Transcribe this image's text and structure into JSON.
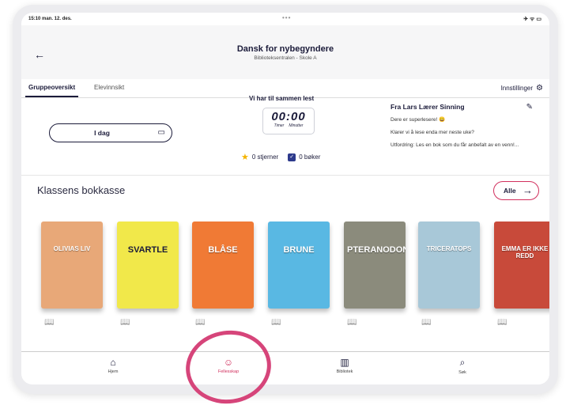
{
  "status": {
    "time": "15:10  man. 12. des.",
    "dots": "•••",
    "system": "✈ ᯤ ▭"
  },
  "header": {
    "back": "←",
    "title": "Dansk for nybegyndere",
    "subtitle": "Biblioteksentralen - Skole A"
  },
  "tabs": {
    "active": "Gruppeoversikt",
    "inactive": "Elevinnsikt",
    "settings": "Innstillinger"
  },
  "today": {
    "label": "I dag"
  },
  "reading": {
    "title": "Vi har til sammen lest",
    "timer": "00:00",
    "hours_label": "Timer",
    "minutes_label": "Minutter",
    "stars": "0 stjerner",
    "books": "0 bøker"
  },
  "message": {
    "from": "Fra Lars Lærer Sinning",
    "line1": "Dere er superlesere! 😀",
    "line2": "Klarer vi å lese enda mer neste uke?",
    "line3": "Utfordring: Les en bok som du får anbefalt av en venn!..."
  },
  "shelf": {
    "title": "Klassens bokkasse",
    "all_label": "Alle"
  },
  "books": [
    {
      "title": "OLIVIAS LIV",
      "color": "#e8a878"
    },
    {
      "title": "SVARTLE",
      "color": "#f1e84a"
    },
    {
      "title": "BLÅSE",
      "color": "#f07a35"
    },
    {
      "title": "BRUNE",
      "color": "#59b8e3"
    },
    {
      "title": "PTERANODON",
      "color": "#8b8b7c"
    },
    {
      "title": "TRICERATOPS",
      "color": "#a8c8d8"
    },
    {
      "title": "EMMA ER IKKE REDD",
      "color": "#c84a3a"
    }
  ],
  "nav": {
    "home": "Hjem",
    "community": "Fellesskap",
    "library": "Bibliotek",
    "search": "Søk"
  },
  "accent": "#d12f5d"
}
